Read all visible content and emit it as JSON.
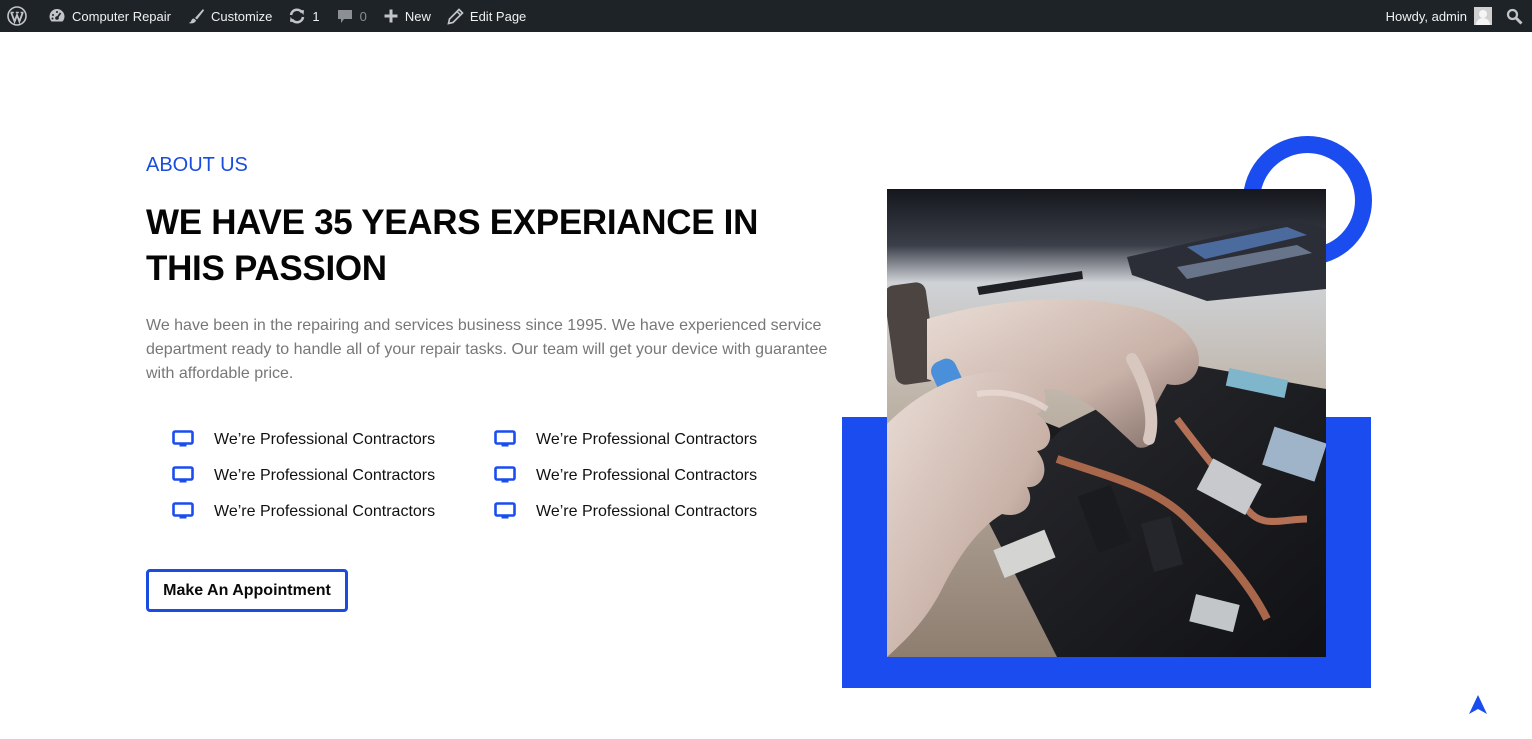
{
  "adminbar": {
    "wp_logo_icon": "wordpress-logo-icon",
    "site_name": "Computer Repair",
    "customize": "Customize",
    "updates_count": "1",
    "comments_count": "0",
    "new": "New",
    "edit_page": "Edit Page",
    "howdy": "Howdy, admin"
  },
  "about": {
    "eyebrow": "ABOUT US",
    "headline": "WE HAVE 35 YEARS EXPERIANCE IN THIS PASSION",
    "paragraph": "We have been in the repairing and services business since 1995. We have experienced service department ready to handle all of your repair tasks. Our team will get your device with guarantee with affordable price.",
    "features": [
      {
        "icon": "monitor-icon",
        "label": "We’re Professional Contractors"
      },
      {
        "icon": "monitor-icon",
        "label": "We’re Professional Contractors"
      },
      {
        "icon": "monitor-icon",
        "label": "We’re Professional Contractors"
      },
      {
        "icon": "monitor-icon",
        "label": "We’re Professional Contractors"
      },
      {
        "icon": "monitor-icon",
        "label": "We’re Professional Contractors"
      },
      {
        "icon": "monitor-icon",
        "label": "We’re Professional Contractors"
      }
    ],
    "cta_label": "Make An Appointment"
  },
  "image": {
    "alt": "Technician repairing a laptop motherboard with a screwdriver"
  },
  "colors": {
    "accent": "#1a4cf0",
    "text_accent": "#1a4ddf",
    "adminbar_bg": "#1d2327"
  }
}
